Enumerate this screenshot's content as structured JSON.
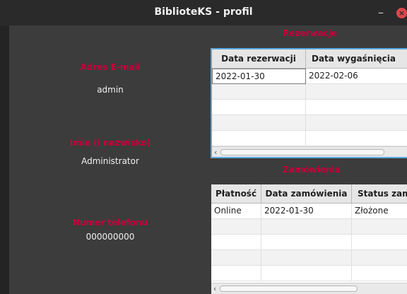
{
  "window": {
    "title": "BiblioteKS - profil",
    "minimize": "–",
    "close": "×"
  },
  "profile": {
    "email_label": "Adres E-mail",
    "email_value": "admin",
    "name_label": "Imie (i nazwisko)",
    "name_value": "Administrator",
    "phone_label": "Numer telefonu",
    "phone_value": "000000000"
  },
  "reservations": {
    "title": "Rezerwacje",
    "columns": [
      "Data rezerwacji",
      "Data wygaśnięcia"
    ],
    "rows": [
      [
        "2022-01-30",
        "2022-02-06"
      ]
    ],
    "scroll_left": "‹"
  },
  "orders": {
    "title": "Zamówienia",
    "columns": [
      "Płatność",
      "Data zamówienia",
      "Status zamówienia"
    ],
    "rows": [
      [
        "Online",
        "2022-01-30",
        "Złożone"
      ]
    ],
    "scroll_left": "‹"
  },
  "colors": {
    "accent_red": "#c6003a",
    "focus_border": "#5aa8e0",
    "background": "#3c3c3c"
  }
}
